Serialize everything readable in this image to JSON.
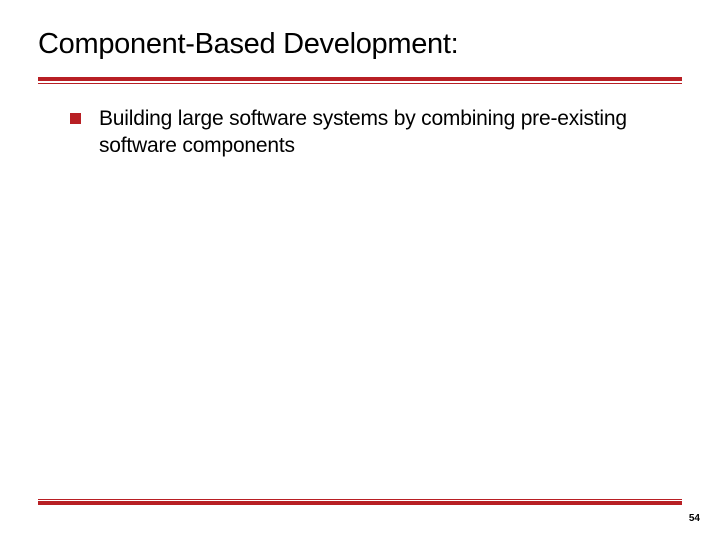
{
  "slide": {
    "title": "Component-Based Development:",
    "bullets": [
      "Building large software systems by combining pre-existing software components"
    ],
    "page_number": "54",
    "accent_color": "#b81f24"
  }
}
